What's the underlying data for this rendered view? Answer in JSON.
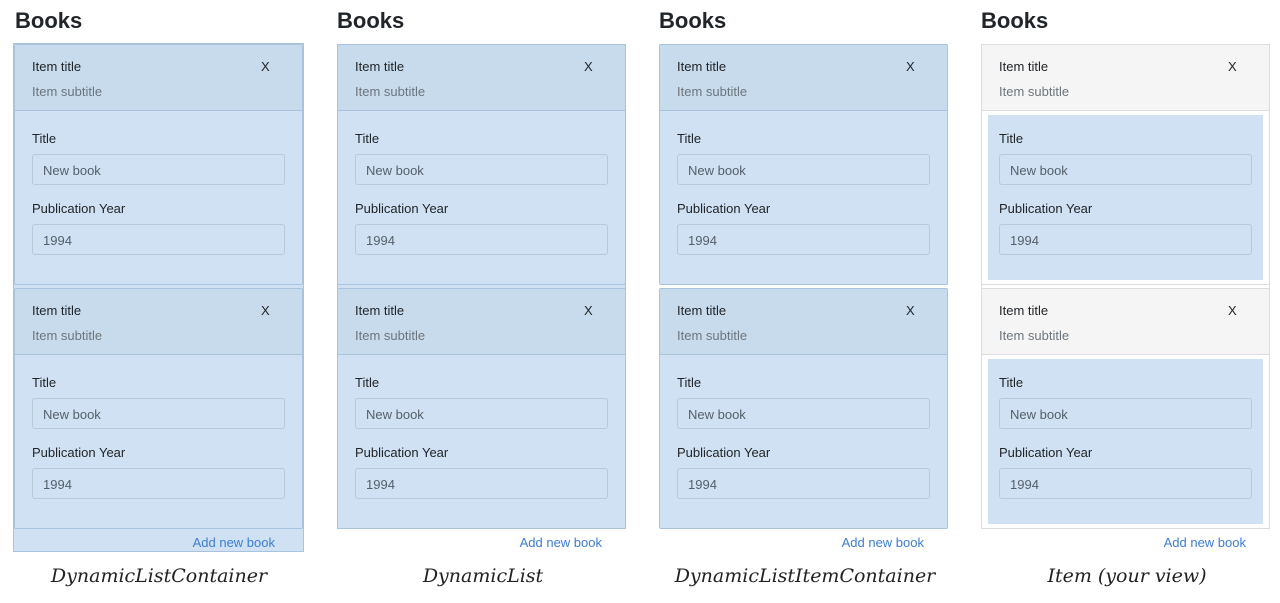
{
  "panels": [
    {
      "heading": "Books",
      "caption": "DynamicListContainer",
      "add_label": "Add new book",
      "items": [
        {
          "title": "Item title",
          "subtitle": "Item subtitle",
          "close": "X",
          "label_title": "Title",
          "value_title": "New book",
          "label_year": "Publication Year",
          "value_year": "1994"
        },
        {
          "title": "Item title",
          "subtitle": "Item subtitle",
          "close": "X",
          "label_title": "Title",
          "value_title": "New book",
          "label_year": "Publication Year",
          "value_year": "1994"
        }
      ]
    },
    {
      "heading": "Books",
      "caption": "DynamicList",
      "add_label": "Add new book",
      "items": [
        {
          "title": "Item title",
          "subtitle": "Item subtitle",
          "close": "X",
          "label_title": "Title",
          "value_title": "New book",
          "label_year": "Publication Year",
          "value_year": "1994"
        },
        {
          "title": "Item title",
          "subtitle": "Item subtitle",
          "close": "X",
          "label_title": "Title",
          "value_title": "New book",
          "label_year": "Publication Year",
          "value_year": "1994"
        }
      ]
    },
    {
      "heading": "Books",
      "caption": "DynamicListItemContainer",
      "add_label": "Add new book",
      "items": [
        {
          "title": "Item title",
          "subtitle": "Item subtitle",
          "close": "X",
          "label_title": "Title",
          "value_title": "New book",
          "label_year": "Publication Year",
          "value_year": "1994"
        },
        {
          "title": "Item title",
          "subtitle": "Item subtitle",
          "close": "X",
          "label_title": "Title",
          "value_title": "New book",
          "label_year": "Publication Year",
          "value_year": "1994"
        }
      ]
    },
    {
      "heading": "Books",
      "caption": "Item (your view)",
      "add_label": "Add new book",
      "items": [
        {
          "title": "Item title",
          "subtitle": "Item subtitle",
          "close": "X",
          "label_title": "Title",
          "value_title": "New book",
          "label_year": "Publication Year",
          "value_year": "1994"
        },
        {
          "title": "Item title",
          "subtitle": "Item subtitle",
          "close": "X",
          "label_title": "Title",
          "value_title": "New book",
          "label_year": "Publication Year",
          "value_year": "1994"
        }
      ]
    }
  ],
  "colors": {
    "highlight": "#cfe1f2",
    "header_highlight": "#c7dbed",
    "border": "#a9c3dd",
    "link": "#3b7dd8"
  }
}
